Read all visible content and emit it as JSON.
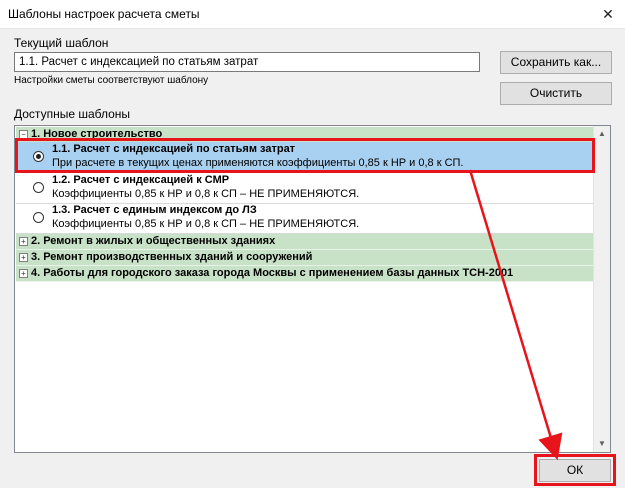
{
  "window": {
    "title": "Шаблоны настроек расчета сметы",
    "close_glyph": "✕"
  },
  "current_template": {
    "label": "Текущий шаблон",
    "value": "1.1. Расчет с индексацией по статьям затрат",
    "hint": "Настройки сметы соответствуют шаблону"
  },
  "buttons": {
    "save_as": "Сохранить как...",
    "clear": "Очистить",
    "ok": "ОК"
  },
  "available": {
    "label": "Доступные шаблоны",
    "groups": [
      {
        "label": "1. Новое строительство",
        "expanded": true,
        "icon": "minus-icon",
        "glyph": "−",
        "items": [
          {
            "title": "1.1. Расчет с индексацией по статьям затрат",
            "desc": "При расчете в текущих ценах применяются коэффициенты 0,85 к НР и 0,8 к СП.",
            "selected": true
          },
          {
            "title": "1.2. Расчет с индексацией к СМР",
            "desc": "Коэффициенты 0,85 к НР и 0,8 к СП – НЕ ПРИМЕНЯЮТСЯ.",
            "selected": false
          },
          {
            "title": "1.3. Расчет с единым индексом до ЛЗ",
            "desc": "Коэффициенты 0,85 к НР и 0,8 к СП – НЕ ПРИМЕНЯЮТСЯ.",
            "selected": false
          }
        ]
      },
      {
        "label": "2. Ремонт в жилых и общественных зданиях",
        "expanded": false,
        "icon": "plus-icon",
        "glyph": "+"
      },
      {
        "label": "3. Ремонт производственных зданий и сооружений",
        "expanded": false,
        "icon": "plus-icon",
        "glyph": "+"
      },
      {
        "label": "4. Работы для городского заказа города Москвы с применением базы данных ТСН-2001",
        "expanded": false,
        "icon": "plus-icon",
        "glyph": "+"
      }
    ]
  },
  "colors": {
    "group_bg": "#c8e2c8",
    "selected_bg": "#a8d0f0",
    "annotation_red": "#e8141c"
  },
  "scrollbar": {
    "up_glyph": "▲",
    "down_glyph": "▼"
  }
}
